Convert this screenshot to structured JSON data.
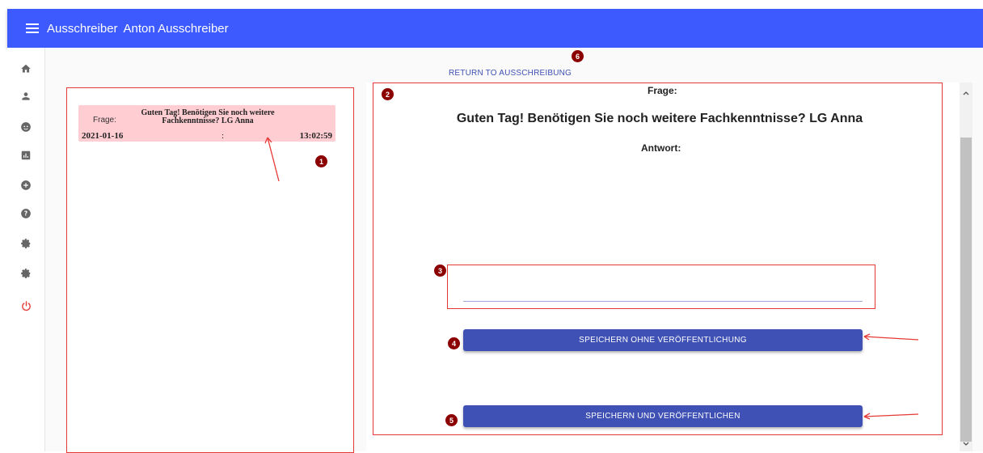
{
  "header": {
    "app_title": "Ausschreiber",
    "user_name": "Anton Ausschreiber"
  },
  "sidebar": {
    "icons": [
      "home-icon",
      "person-icon",
      "face-icon",
      "chart-icon",
      "add-circle-icon",
      "help-icon",
      "settings-icon",
      "settings-icon",
      "power-icon"
    ]
  },
  "return_link": "RETURN TO AUSSCHREIBUNG",
  "question_list": {
    "items": [
      {
        "label": "Frage:",
        "text": "Guten Tag! Benötigen Sie noch weitere Fachkenntnisse? LG Anna",
        "date": "2021-01-16",
        "separator": ":",
        "time": "13:02:59"
      }
    ]
  },
  "detail": {
    "frage_label": "Frage:",
    "frage_text": "Guten Tag! Benötigen Sie noch weitere Fachkenntnisse? LG Anna",
    "antwort_label": "Antwort:",
    "answer_value": ""
  },
  "buttons": {
    "save_unpublished": "SPEICHERN OHNE VERÖFFENTLICHUNG",
    "save_published": "SPEICHERN UND VERÖFFENTLICHEN"
  },
  "annotations": {
    "badges": [
      "1",
      "2",
      "3",
      "4",
      "5",
      "6"
    ],
    "marker_color": "#e53935",
    "badge_color": "#8b0000"
  },
  "colors": {
    "header": "#3d5afe",
    "button": "#3f51b5",
    "card": "#ffcdd2",
    "power": "#e53935"
  }
}
